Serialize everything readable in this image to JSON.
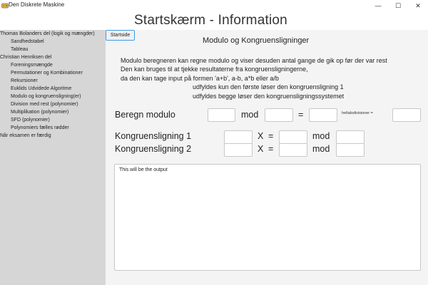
{
  "window": {
    "title": "Den Diskrete Maskine",
    "minimize_glyph": "—",
    "maximize_glyph": "☐",
    "close_glyph": "✕"
  },
  "header": {
    "title": "Startskærm - Information"
  },
  "sidebar": {
    "start_button": "Startside",
    "items": [
      {
        "label": "Thomas Bolanders del (logik og mængder)",
        "level": 0
      },
      {
        "label": "Sandhedstabel",
        "level": 1
      },
      {
        "label": "Tableau",
        "level": 1
      },
      {
        "label": "Christian Henriksen del",
        "level": 0
      },
      {
        "label": "Foreningsmængde",
        "level": 1
      },
      {
        "label": "Permutationer og Kombinationer",
        "level": 1
      },
      {
        "label": "Rekursioner",
        "level": 1
      },
      {
        "label": "Euklids Udvidede Algoritme",
        "level": 1
      },
      {
        "label": "Modulo og kongruensligning(er)",
        "level": 1
      },
      {
        "label": "Division med rest (polynomier)",
        "level": 1
      },
      {
        "label": "Multiplikation (polynomier)",
        "level": 1
      },
      {
        "label": "SFD (polynomier)",
        "level": 1
      },
      {
        "label": "Polynomiers fælles rødder",
        "level": 1
      },
      {
        "label": "Når eksamen er færdig",
        "level": 0
      }
    ]
  },
  "main": {
    "subtitle": "Modulo og Kongruensligninger",
    "description": [
      "Modulo beregneren kan regne modulo og viser desuden antal gange de gik op før der var rest",
      "Den kan bruges til at tjekke resultaterne fra kongruensligningerne,",
      "da den kan tage input på formen 'a+b', a-b, a*b eller a/b",
      "udfyldes kun den første løser den kongruensligning 1",
      "udfyldes begge løser den kongruensligningssystemet"
    ],
    "modulo_row": {
      "label": "Beregn modulo",
      "mod": "mod",
      "equals": "=",
      "division_label": "heltalsdivisioner ="
    },
    "congruence_1": {
      "label": "Kongruensligning 1",
      "x": "X",
      "equals": "=",
      "mod": "mod"
    },
    "congruence_2": {
      "label": "Kongruensligning 2",
      "x": "X",
      "equals": "=",
      "mod": "mod"
    },
    "output": "This will be the output"
  }
}
